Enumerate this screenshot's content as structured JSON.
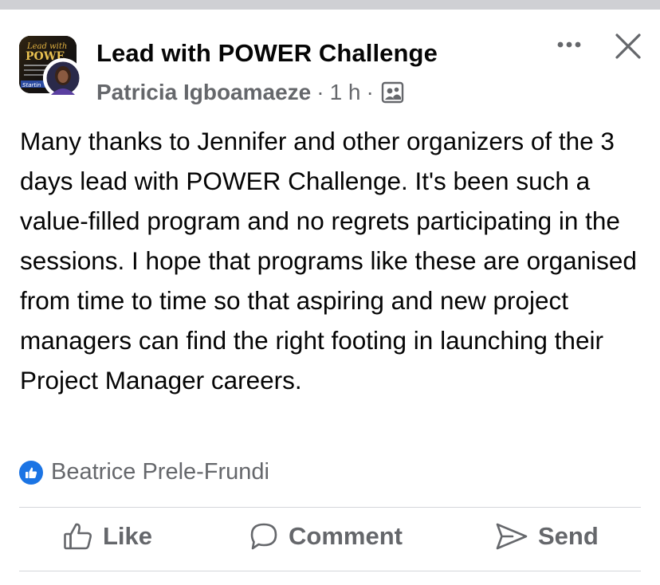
{
  "group_avatar": {
    "logo_text_top": "Lead with",
    "logo_text_mid": "POWE",
    "logo_text_bottom": "Startin"
  },
  "post": {
    "group_name": "Lead with POWER Challenge",
    "author": "Patricia Igboamaeze",
    "separator": "·",
    "timestamp": "1 h",
    "audience_icon": "group-members-icon",
    "body": "Many thanks to Jennifer and other organizers of the 3 days lead with POWER Challenge. It's been such a value-filled program and no regrets participating in the sessions. I hope that programs like these are organised from time to time so that aspiring and new project managers can find the right footing in launching their Project Manager careers."
  },
  "reactions": {
    "icon": "thumbs-up-icon",
    "reactor_name": "Beatrice Prele-Frundi"
  },
  "actions": {
    "like_label": "Like",
    "comment_label": "Comment",
    "send_label": "Send"
  },
  "colors": {
    "text_primary": "#050505",
    "text_secondary": "#65676b",
    "like_badge": "#1b74e4",
    "divider": "#d4d6da"
  }
}
